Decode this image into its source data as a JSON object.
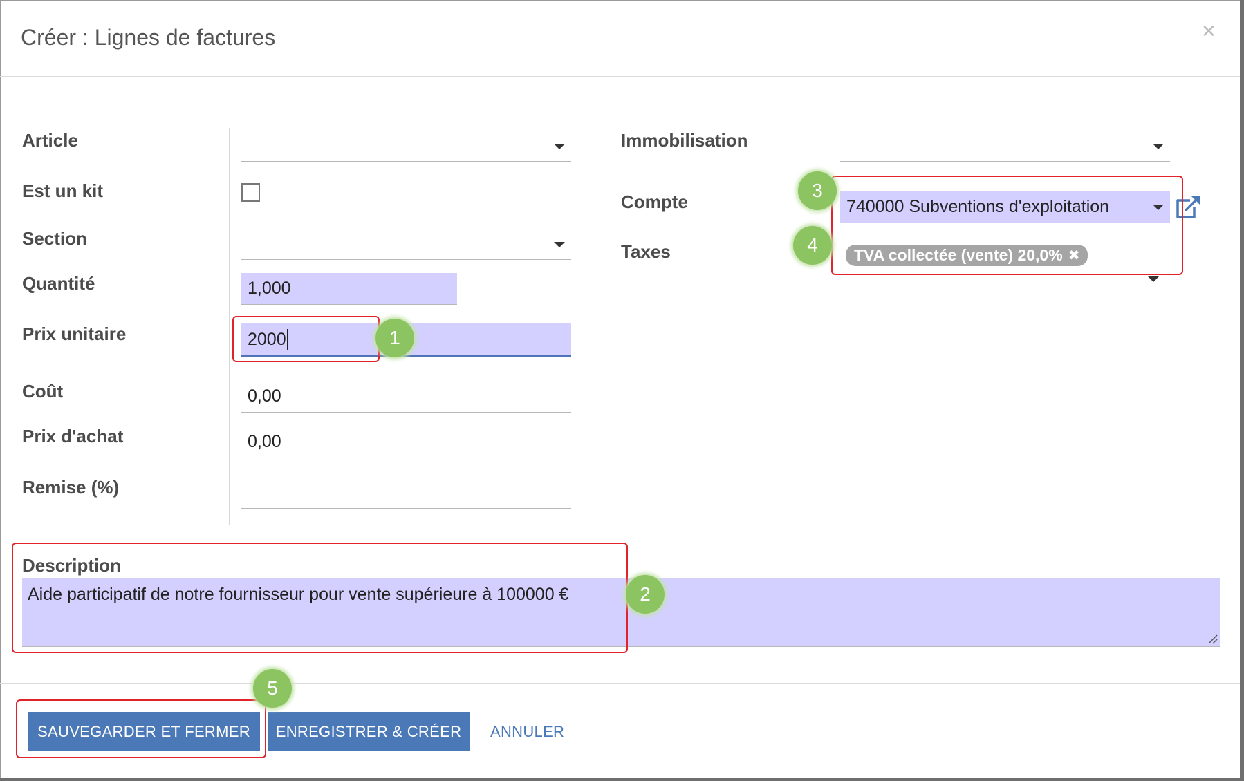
{
  "dialog": {
    "title": "Créer : Lignes de factures",
    "close_glyph": "×"
  },
  "form_left": {
    "article": {
      "label": "Article",
      "value": ""
    },
    "est_un_kit": {
      "label": "Est un kit",
      "checked": false
    },
    "section": {
      "label": "Section",
      "value": ""
    },
    "quantite": {
      "label": "Quantité",
      "value": "1,000"
    },
    "prix_unitaire": {
      "label": "Prix unitaire",
      "value": "2000"
    },
    "cout": {
      "label": "Coût",
      "value": "0,00"
    },
    "prix_achat": {
      "label": "Prix d'achat",
      "value": "0,00"
    },
    "remise": {
      "label": "Remise (%)",
      "value": ""
    }
  },
  "form_right": {
    "immobilisation": {
      "label": "Immobilisation",
      "value": ""
    },
    "compte": {
      "label": "Compte",
      "value": "740000 Subventions d'exploitation",
      "external_icon": "external-link-icon"
    },
    "taxes": {
      "label": "Taxes",
      "tags": [
        {
          "label": "TVA collectée (vente) 20,0%",
          "remove_glyph": "✖"
        }
      ]
    }
  },
  "description": {
    "label": "Description",
    "value": "Aide participatif de notre fournisseur pour vente supérieure à 100000 €"
  },
  "annotations": {
    "badges": [
      "1",
      "2",
      "3",
      "4",
      "5"
    ],
    "highlight_color": "#e0242a",
    "badge_color": "#8dc462"
  },
  "footer": {
    "save_close_label": "SAUVEGARDER ET FERMER",
    "save_create_label": "ENREGISTRER & CRÉER",
    "cancel_label": "ANNULER"
  },
  "colors": {
    "primary": "#4b79b8",
    "filled_field": "#d3d0ff",
    "tag_bg": "#a5a5a5"
  }
}
